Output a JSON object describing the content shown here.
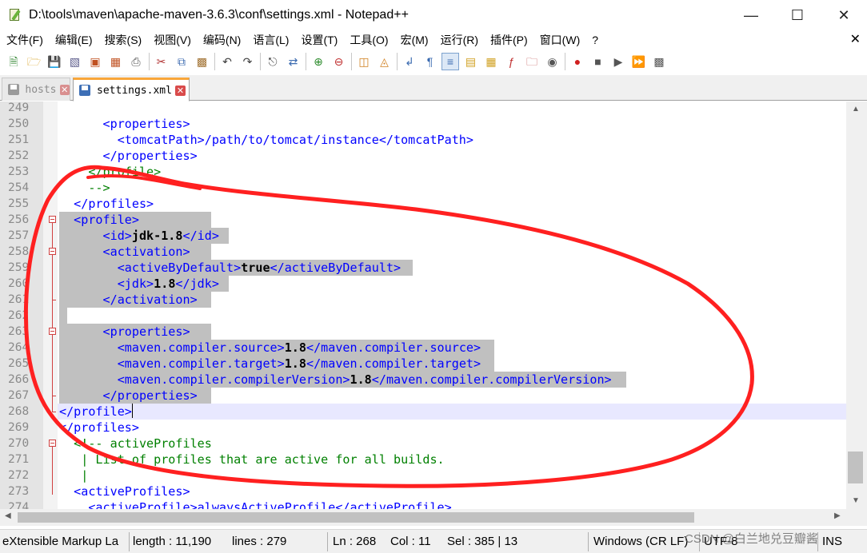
{
  "window": {
    "title": "D:\\tools\\maven\\apache-maven-3.6.3\\conf\\settings.xml - Notepad++"
  },
  "menu": [
    "文件(F)",
    "编辑(E)",
    "搜索(S)",
    "视图(V)",
    "编码(N)",
    "语言(L)",
    "设置(T)",
    "工具(O)",
    "宏(M)",
    "运行(R)",
    "插件(P)",
    "窗口(W)",
    "?"
  ],
  "tabs": [
    {
      "label": "hosts",
      "active": false
    },
    {
      "label": "settings.xml",
      "active": true
    }
  ],
  "editor": {
    "lines": [
      {
        "n": "249",
        "segs": []
      },
      {
        "n": "250",
        "segs": [
          [
            "tag",
            "      <properties>"
          ]
        ]
      },
      {
        "n": "251",
        "segs": [
          [
            "tag",
            "        <tomcatPath>/path/to/tomcat/instance</tomcatPath>"
          ]
        ]
      },
      {
        "n": "252",
        "segs": [
          [
            "tag",
            "      </properties>"
          ]
        ]
      },
      {
        "n": "253",
        "segs": [
          [
            "cmt",
            "    </profile>"
          ]
        ]
      },
      {
        "n": "254",
        "segs": [
          [
            "cmt",
            "    -->"
          ]
        ]
      },
      {
        "n": "255",
        "segs": [
          [
            "tag",
            "  </profiles>"
          ]
        ]
      },
      {
        "n": "256",
        "segs": [
          [
            "tag",
            "  <profile>"
          ]
        ]
      },
      {
        "n": "257",
        "segs": [
          [
            "tag",
            "      <id>"
          ],
          [
            "txt",
            "jdk-1.8"
          ],
          [
            "tag",
            "</id>"
          ]
        ]
      },
      {
        "n": "258",
        "segs": [
          [
            "tag",
            "      <activation>"
          ]
        ]
      },
      {
        "n": "259",
        "segs": [
          [
            "tag",
            "        <activeByDefault>"
          ],
          [
            "txt",
            "true"
          ],
          [
            "tag",
            "</activeByDefault>"
          ]
        ]
      },
      {
        "n": "260",
        "segs": [
          [
            "tag",
            "        <jdk>"
          ],
          [
            "txt",
            "1.8"
          ],
          [
            "tag",
            "</jdk>"
          ]
        ]
      },
      {
        "n": "261",
        "segs": [
          [
            "tag",
            "      </activation>"
          ]
        ]
      },
      {
        "n": "262",
        "segs": []
      },
      {
        "n": "263",
        "segs": [
          [
            "tag",
            "      <properties>"
          ]
        ]
      },
      {
        "n": "264",
        "segs": [
          [
            "tag",
            "        <maven.compiler.source>"
          ],
          [
            "txt",
            "1.8"
          ],
          [
            "tag",
            "</maven.compiler.source>"
          ]
        ]
      },
      {
        "n": "265",
        "segs": [
          [
            "tag",
            "        <maven.compiler.target>"
          ],
          [
            "txt",
            "1.8"
          ],
          [
            "tag",
            "</maven.compiler.target>"
          ]
        ]
      },
      {
        "n": "266",
        "segs": [
          [
            "tag",
            "        <maven.compiler.compilerVersion>"
          ],
          [
            "txt",
            "1.8"
          ],
          [
            "tag",
            "</maven.compiler.compilerVersion>"
          ]
        ]
      },
      {
        "n": "267",
        "segs": [
          [
            "tag",
            "      </properties>"
          ]
        ]
      },
      {
        "n": "268",
        "segs": [
          [
            "tag",
            "</profile>"
          ]
        ]
      },
      {
        "n": "269",
        "segs": [
          [
            "tag",
            "</profiles>"
          ]
        ]
      },
      {
        "n": "270",
        "segs": [
          [
            "cmt",
            "  <!-- activeProfiles"
          ]
        ]
      },
      {
        "n": "271",
        "segs": [
          [
            "cmt",
            "   | List of profiles that are active for all builds."
          ]
        ]
      },
      {
        "n": "272",
        "segs": [
          [
            "cmt",
            "   |"
          ]
        ]
      },
      {
        "n": "273",
        "segs": [
          [
            "tag",
            "  <activeProfiles>"
          ]
        ]
      },
      {
        "n": "274",
        "segs": [
          [
            "tag",
            "    <activeProfile>alwaysActiveProfile</activeProfile>"
          ]
        ]
      }
    ]
  },
  "status": {
    "language": "eXtensible Markup La",
    "length": "length : 11,190",
    "lines": "lines : 279",
    "ln": "Ln : 268",
    "col": "Col : 11",
    "sel": "Sel : 385 | 13",
    "eol": "Windows (CR LF)",
    "encoding": "UTF-8",
    "mode": "INS"
  },
  "watermark": "CSDN @白兰地兑豆瓣酱",
  "colors": {
    "tag": "#0000ff",
    "comment": "#008000",
    "selection": "#c0c0c0",
    "caret_line": "#e8e8ff",
    "annotation": "#ff2020"
  },
  "icons": [
    "new-file-icon",
    "open-file-icon",
    "save-icon",
    "save-all-icon",
    "close-icon",
    "close-all-icon",
    "print-icon",
    "cut-icon",
    "copy-icon",
    "paste-icon",
    "undo-icon",
    "redo-icon",
    "find-icon",
    "replace-icon",
    "zoom-in-icon",
    "zoom-out-icon",
    "sync-v-icon",
    "sync-h-icon",
    "word-wrap-icon",
    "show-all-chars-icon",
    "indent-guide-icon",
    "udl-icon",
    "doc-map-icon",
    "function-list-icon",
    "folder-workspace-icon",
    "monitor-icon",
    "record-macro-icon",
    "stop-macro-icon",
    "play-macro-icon",
    "run-macro-multiple-icon",
    "save-macro-icon"
  ]
}
